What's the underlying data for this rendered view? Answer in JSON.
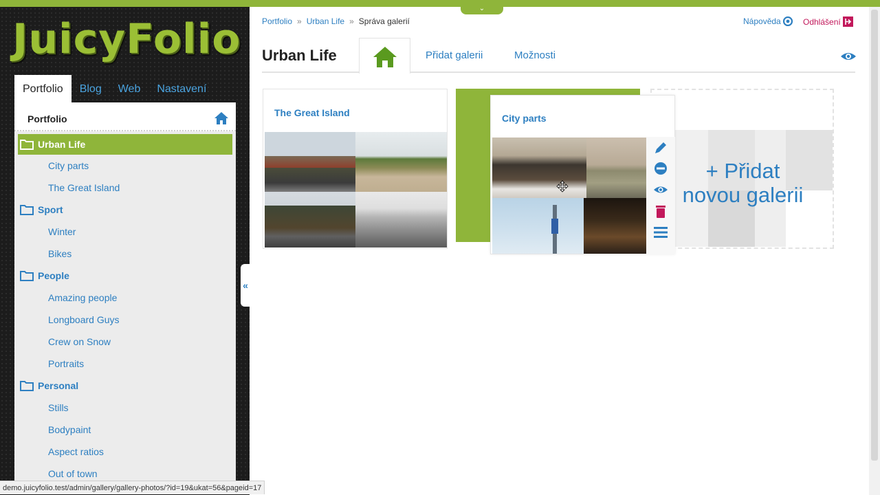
{
  "app": {
    "logo": "JuicyFolio"
  },
  "colors": {
    "accent": "#8fb53a",
    "link": "#2d7fc1",
    "logout": "#c2185b"
  },
  "main_tabs": [
    {
      "label": "Portfolio",
      "active": true
    },
    {
      "label": "Blog"
    },
    {
      "label": "Web"
    },
    {
      "label": "Nastavení"
    }
  ],
  "tree": {
    "title": "Portfolio",
    "items": [
      {
        "type": "folder",
        "label": "Urban Life",
        "selected": true
      },
      {
        "type": "child",
        "label": "City parts"
      },
      {
        "type": "child",
        "label": "The Great Island"
      },
      {
        "type": "folder",
        "label": "Sport"
      },
      {
        "type": "child",
        "label": "Winter"
      },
      {
        "type": "child",
        "label": "Bikes"
      },
      {
        "type": "folder",
        "label": "People"
      },
      {
        "type": "child",
        "label": "Amazing people"
      },
      {
        "type": "child",
        "label": "Longboard Guys"
      },
      {
        "type": "child",
        "label": "Crew on Snow"
      },
      {
        "type": "child",
        "label": "Portraits"
      },
      {
        "type": "folder",
        "label": "Personal"
      },
      {
        "type": "child",
        "label": "Stills"
      },
      {
        "type": "child",
        "label": "Bodypaint"
      },
      {
        "type": "child",
        "label": "Aspect ratios"
      },
      {
        "type": "child",
        "label": "Out of town"
      }
    ]
  },
  "collapse_label": "«",
  "breadcrumb": {
    "items": [
      "Portfolio",
      "Urban Life"
    ],
    "current": "Správa galerií",
    "separator": "»"
  },
  "header_links": {
    "help": "Nápověda",
    "logout": "Odhlášení"
  },
  "page": {
    "title": "Urban Life"
  },
  "sub_tabs": {
    "add_gallery": "Přidat galerii",
    "options": "Možnosti"
  },
  "galleries": [
    {
      "title": "The Great Island"
    },
    {
      "title": "City parts"
    }
  ],
  "add_gallery": {
    "line1": "+ Přidat",
    "line2": "novou galerii"
  },
  "status_bar": "demo.juicyfolio.test/admin/gallery/gallery-photos/?id=19&ukat=56&pageid=17",
  "icons": {
    "tree_home": "home-icon",
    "tab_home": "home-icon",
    "folder": "folder-icon",
    "help": "help-icon",
    "logout": "logout-icon",
    "view": "eye-icon",
    "tools": [
      "pencil-icon",
      "minus-circle-icon",
      "eye-icon",
      "trash-icon",
      "menu-icon"
    ]
  }
}
